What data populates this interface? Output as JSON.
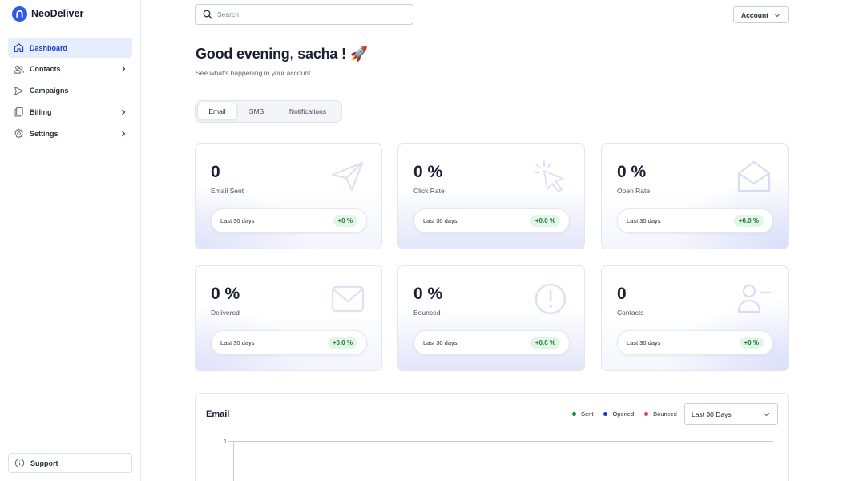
{
  "brand": {
    "name": "NeoDeliver",
    "accent": "#2f57e8"
  },
  "sidebar": {
    "items": [
      {
        "label": "Dashboard",
        "icon": "home-icon",
        "active": true
      },
      {
        "label": "Contacts",
        "icon": "users-icon",
        "expandable": true
      },
      {
        "label": "Campaigns",
        "icon": "send-icon"
      },
      {
        "label": "Billing",
        "icon": "documents-icon",
        "expandable": true
      },
      {
        "label": "Settings",
        "icon": "gear-icon",
        "expandable": true
      }
    ],
    "support_label": "Support"
  },
  "header": {
    "search_placeholder": "Search",
    "account_label": "Account"
  },
  "greeting": {
    "title": "Good evening, sacha ! 🚀",
    "subtitle": "See what's happening in your account"
  },
  "tabs": [
    {
      "label": "Email",
      "active": true
    },
    {
      "label": "SMS"
    },
    {
      "label": "Notifications"
    }
  ],
  "cards": [
    {
      "value": "0",
      "label": "Email Sent",
      "period": "Last 30 days",
      "delta": "+0 %",
      "icon": "paper-plane-icon"
    },
    {
      "value": "0 %",
      "label": "Click Rate",
      "period": "Last 30 days",
      "delta": "+0.0 %",
      "icon": "cursor-click-icon"
    },
    {
      "value": "0 %",
      "label": "Open Rate",
      "period": "Last 30 days",
      "delta": "+0.0 %",
      "icon": "open-envelope-icon"
    },
    {
      "value": "0 %",
      "label": "Delivered",
      "period": "Last 30 days",
      "delta": "+0.0 %",
      "icon": "envelope-icon"
    },
    {
      "value": "0 %",
      "label": "Bounced",
      "period": "Last 30 days",
      "delta": "+0.0 %",
      "icon": "alert-circle-icon"
    },
    {
      "value": "0",
      "label": "Contacts",
      "period": "Last 30 days",
      "delta": "+0 %",
      "icon": "user-icon"
    }
  ],
  "email_panel": {
    "title": "Email",
    "legend": [
      {
        "label": "Sent",
        "color": "#1a8a2e"
      },
      {
        "label": "Opened",
        "color": "#1a2fd0"
      },
      {
        "label": "Bounced",
        "color": "#e23b4a"
      }
    ],
    "range": "Last 30 Days",
    "y_tick": "1"
  }
}
